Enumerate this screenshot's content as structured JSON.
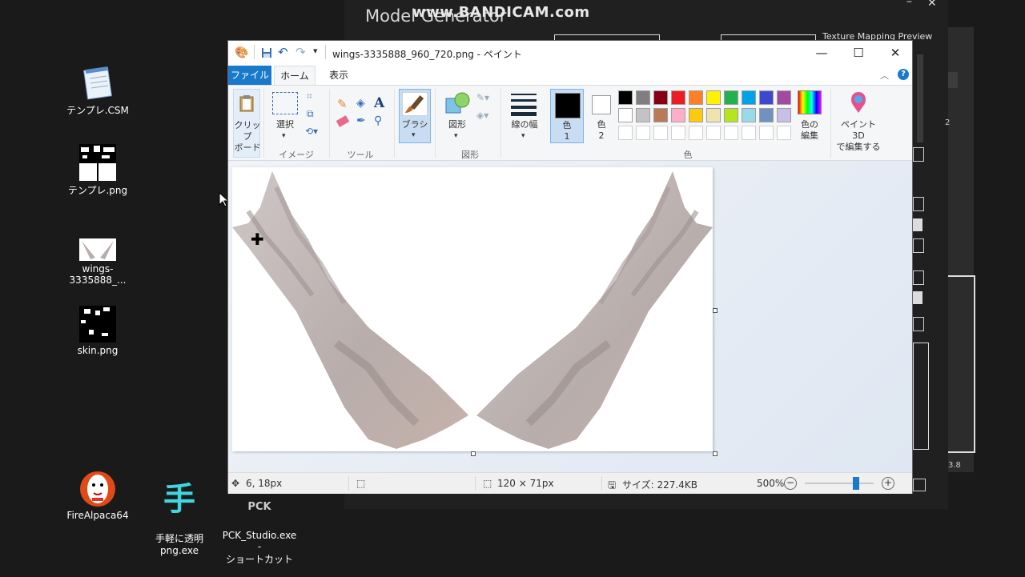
{
  "background_app": {
    "title": "Model Generator",
    "watermark": "www.BANDICAM.com",
    "texture_preview_label": "Texture Mapping Preview",
    "side_numbers": [
      "2",
      "3.8"
    ]
  },
  "desktop_icons": [
    {
      "label": "テンプレ.CSM",
      "icon": "notepad-icon"
    },
    {
      "label": "テンプレ.png",
      "icon": "image-file-icon"
    },
    {
      "label": "wings-3335888_...",
      "icon": "wings-thumbnail-icon"
    },
    {
      "label": "skin.png",
      "icon": "image-file-icon"
    },
    {
      "label": "FireAlpaca64",
      "icon": "firealpaca-icon"
    },
    {
      "label": "手軽に透明\npng.exe",
      "icon": "tegaru-icon"
    },
    {
      "label": "PCK_Studio.exe -\nショートカット",
      "icon": "pck-studio-icon"
    }
  ],
  "paint": {
    "title": "wings-3335888_960_720.png - ペイント",
    "tabs": [
      "ファイル",
      "ホーム",
      "表示"
    ],
    "ribbon": {
      "clipboard_label": "クリップ\nボード",
      "select_label": "選択",
      "image_group": "イメージ",
      "tools_group": "ツール",
      "brush_label": "ブラシ",
      "shapes_label": "図形",
      "shapes_group": "図形",
      "line_width_label": "線の幅",
      "color1_label": "色\n1",
      "color2_label": "色\n2",
      "colors_group": "色",
      "edit_colors_label": "色の\n編集",
      "paint3d_label": "ペイント 3D\nで編集する"
    },
    "palette_row1": [
      "#000000",
      "#7f7f7f",
      "#880015",
      "#ed1c24",
      "#ff7f27",
      "#fff200",
      "#22b14c",
      "#00a2e8",
      "#3f48cc",
      "#a349a4"
    ],
    "palette_row2": [
      "#ffffff",
      "#c3c3c3",
      "#b97a57",
      "#ffaec9",
      "#ffc90e",
      "#efe4b0",
      "#b5e61d",
      "#99d9ea",
      "#7092be",
      "#c8bfe7"
    ],
    "status": {
      "cursor_pos": "6, 18px",
      "image_size": "120 × 71px",
      "file_size": "サイズ: 227.4KB",
      "zoom": "500%"
    }
  }
}
